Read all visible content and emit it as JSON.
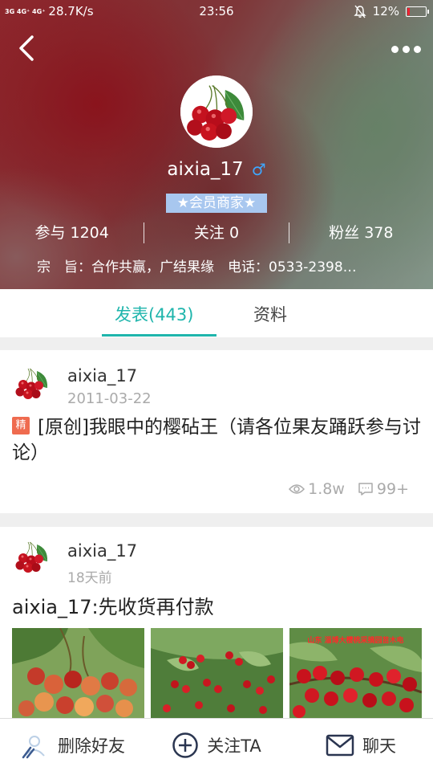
{
  "status_bar": {
    "signal_left": "3G 4G⁺ 4G⁺",
    "net_speed": "28.7K/s",
    "time": "23:56",
    "battery": "12%",
    "battery_level": 0.12
  },
  "profile": {
    "username": "aixia_17",
    "gender_symbol": "♂",
    "badge": "★会员商家★",
    "stats": [
      {
        "label": "参与 1204"
      },
      {
        "label": "关注 0"
      },
      {
        "label": "粉丝 378"
      }
    ],
    "motto": "宗　旨：合作共赢，广结果缘　电话：0533-2398…"
  },
  "tabs": [
    {
      "label": "发表(443)",
      "active": true
    },
    {
      "label": "资料",
      "active": false
    }
  ],
  "posts": [
    {
      "username": "aixia_17",
      "date": "2011-03-22",
      "tag": "精",
      "title": "[原创]我眼中的樱砧王（请各位果友踊跃参与讨论）",
      "views": "1.8w",
      "comments": "99+"
    },
    {
      "username": "aixia_17",
      "date": "18天前",
      "title": "aixia_17:先收货再付款",
      "photo_caption": "山东 淄博大樱桃采摘园苗木电"
    }
  ],
  "bottom_bar": {
    "delete_friend": "删除好友",
    "follow": "关注TA",
    "chat": "聊天"
  },
  "colors": {
    "accent": "#1fb5ac",
    "badge_bg": "#a8c7ef",
    "jing_tag": "#ef6b4f",
    "gender": "#3ea7ff"
  }
}
